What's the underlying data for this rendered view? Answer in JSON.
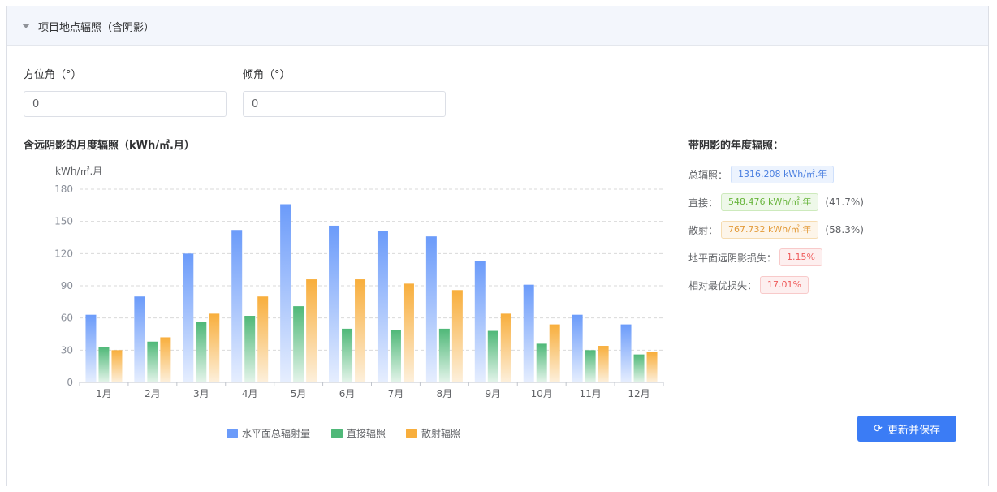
{
  "panel": {
    "title": "项目地点辐照（含阴影）"
  },
  "fields": {
    "azimuth": {
      "label": "方位角（°）",
      "value": "0"
    },
    "tilt": {
      "label": "倾角（°）",
      "value": "0"
    }
  },
  "chart_section": {
    "title": "含远阴影的月度辐照（kWh/㎡.月）"
  },
  "annual": {
    "title": "带阴影的年度辐照：",
    "total_label": "总辐照：",
    "total_value": "1316.208 kWh/㎡.年",
    "direct_label": "直接：",
    "direct_value": "548.476 kWh/㎡.年",
    "direct_pct": "(41.7%)",
    "diffuse_label": "散射：",
    "diffuse_value": "767.732 kWh/㎡.年",
    "diffuse_pct": "(58.3%)",
    "horizon_label": "地平面远阴影损失：",
    "horizon_value": "1.15%",
    "relative_label": "相对最优损失：",
    "relative_value": "17.01%"
  },
  "button": {
    "label": "更新并保存",
    "icon": "refresh-icon"
  },
  "colors": {
    "total": "#6b9bfa",
    "direct": "#4fb878",
    "diffuse": "#f8ae3c",
    "grid": "#d9d9d9",
    "axis_text": "#8a8f99",
    "button": "#3b7cf5"
  },
  "chart_data": {
    "type": "bar",
    "ylabel": "kWh/㎡.月",
    "ylim": [
      0,
      180
    ],
    "yticks": [
      0,
      30,
      60,
      90,
      120,
      150,
      180
    ],
    "grid": true,
    "legend_position": "bottom",
    "categories": [
      "1月",
      "2月",
      "3月",
      "4月",
      "5月",
      "6月",
      "7月",
      "8月",
      "9月",
      "10月",
      "11月",
      "12月"
    ],
    "series": [
      {
        "name": "水平面总辐射量",
        "values": [
          63,
          80,
          120,
          142,
          166,
          146,
          141,
          136,
          113,
          91,
          63,
          54
        ]
      },
      {
        "name": "直接辐照",
        "values": [
          33,
          38,
          56,
          62,
          71,
          50,
          49,
          50,
          48,
          36,
          30,
          26
        ]
      },
      {
        "name": "散射辐照",
        "values": [
          30,
          42,
          64,
          80,
          96,
          96,
          92,
          86,
          64,
          54,
          34,
          28
        ]
      }
    ]
  }
}
